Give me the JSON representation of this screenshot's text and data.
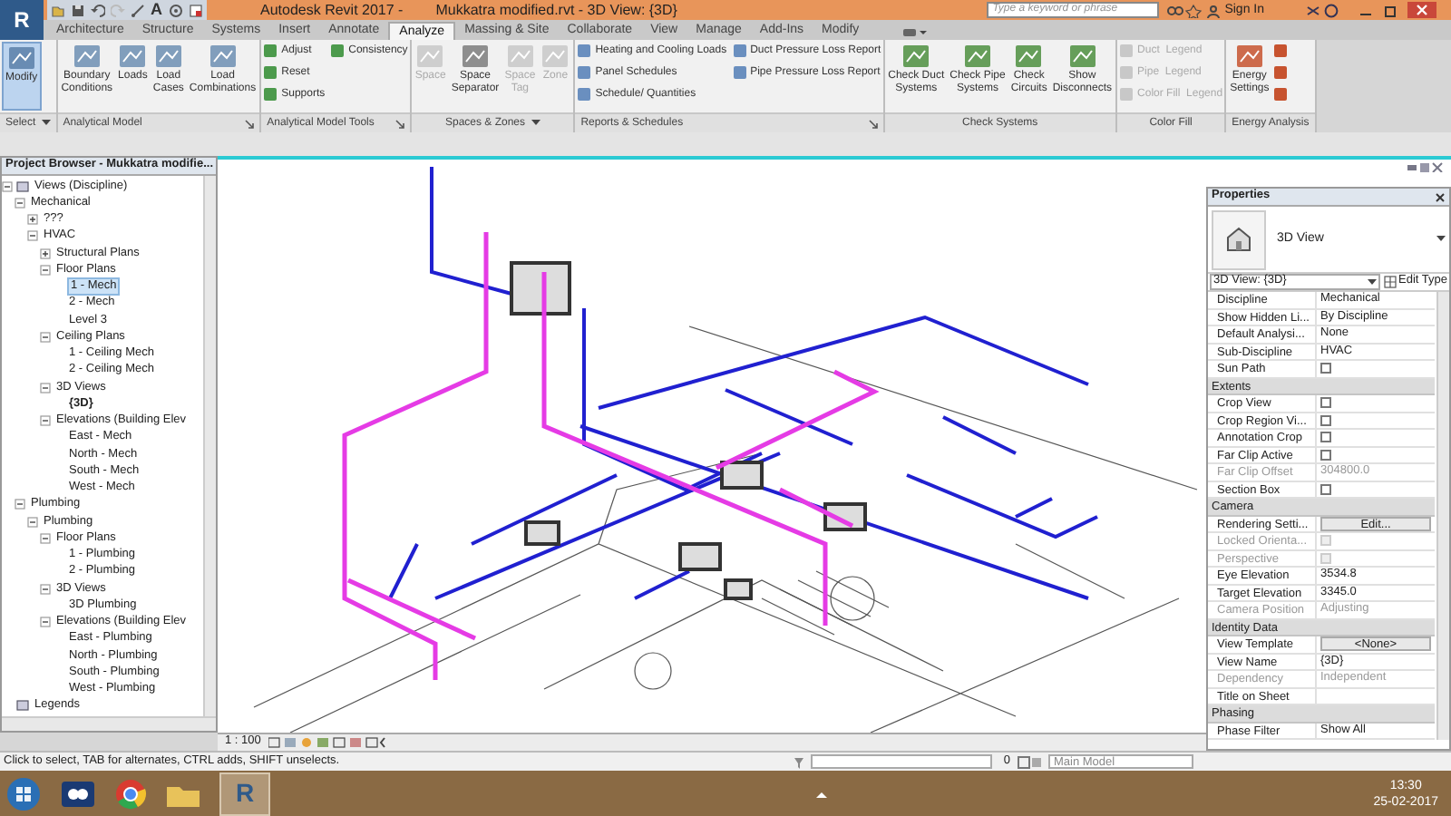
{
  "title_bar": {
    "app_letter": "R",
    "text_tool": "A",
    "title": "Autodesk Revit 2017 -",
    "document": "Mukkatra modified.rvt - 3D View: {3D}",
    "search": {
      "placeholder": "Type a keyword or phrase"
    },
    "sign_in": "Sign In"
  },
  "tabs": [
    {
      "label": "Architecture",
      "selected": false
    },
    {
      "label": "Structure",
      "selected": false
    },
    {
      "label": "Systems",
      "selected": false
    },
    {
      "label": "Insert",
      "selected": false
    },
    {
      "label": "Annotate",
      "selected": false
    },
    {
      "label": "Analyze",
      "selected": true
    },
    {
      "label": "Massing & Site",
      "selected": false
    },
    {
      "label": "Collaborate",
      "selected": false
    },
    {
      "label": "View",
      "selected": false
    },
    {
      "label": "Manage",
      "selected": false
    },
    {
      "label": "Add-Ins",
      "selected": false
    },
    {
      "label": "Modify",
      "selected": false
    }
  ],
  "ribbon": {
    "panels": [
      {
        "label": "Select",
        "dropdown": true,
        "launcher": false,
        "tools": [
          {
            "kind": "large",
            "label": "Modify",
            "active": true,
            "disabled": false
          }
        ]
      },
      {
        "label": "Analytical Model",
        "dropdown": false,
        "launcher": true,
        "tools": [
          {
            "kind": "large",
            "label": "Boundary\nConditions",
            "active": false,
            "disabled": false
          },
          {
            "kind": "large",
            "label": "Loads",
            "active": false,
            "disabled": false
          },
          {
            "kind": "large",
            "label": "Load\nCases",
            "active": false,
            "disabled": false
          },
          {
            "kind": "large",
            "label": "Load\nCombinations",
            "active": false,
            "disabled": false
          }
        ]
      },
      {
        "label": "Analytical Model Tools",
        "dropdown": false,
        "launcher": true,
        "tools": [
          {
            "kind": "small",
            "label": "Adjust",
            "disabled": false
          },
          {
            "kind": "small",
            "label": "Reset",
            "disabled": false
          },
          {
            "kind": "small",
            "label": "Supports",
            "disabled": false
          },
          {
            "kind": "small",
            "label": "Consistency",
            "disabled": false
          }
        ]
      },
      {
        "label": "Spaces & Zones",
        "dropdown": true,
        "launcher": false,
        "tools": [
          {
            "kind": "large",
            "label": "Space",
            "active": false,
            "disabled": true
          },
          {
            "kind": "large",
            "label": "Space\nSeparator",
            "active": false,
            "disabled": false
          },
          {
            "kind": "large",
            "label": "Space\nTag",
            "active": false,
            "disabled": true
          },
          {
            "kind": "large",
            "label": "Zone",
            "active": false,
            "disabled": true
          }
        ]
      },
      {
        "label": "Reports & Schedules",
        "dropdown": false,
        "launcher": true,
        "tools": [
          {
            "kind": "small",
            "label": "Heating and Cooling Loads",
            "disabled": false
          },
          {
            "kind": "small",
            "label": "Panel Schedules",
            "disabled": false
          },
          {
            "kind": "small",
            "label": "Schedule/ Quantities",
            "disabled": false
          },
          {
            "kind": "small",
            "label": "Duct Pressure Loss Report",
            "disabled": false
          },
          {
            "kind": "small",
            "label": "Pipe Pressure Loss Report",
            "disabled": false
          }
        ]
      },
      {
        "label": "Check Systems",
        "dropdown": false,
        "launcher": false,
        "tools": [
          {
            "kind": "large",
            "label": "Check Duct\nSystems",
            "active": false,
            "disabled": false
          },
          {
            "kind": "large",
            "label": "Check Pipe\nSystems",
            "active": false,
            "disabled": false
          },
          {
            "kind": "large",
            "label": "Check\nCircuits",
            "active": false,
            "disabled": false
          },
          {
            "kind": "large",
            "label": "Show\nDisconnects",
            "active": false,
            "disabled": false
          }
        ]
      },
      {
        "label": "Color Fill",
        "dropdown": false,
        "launcher": false,
        "tools": [
          {
            "kind": "small",
            "label": "Duct  Legend",
            "disabled": true
          },
          {
            "kind": "small",
            "label": "Pipe  Legend",
            "disabled": true
          },
          {
            "kind": "small",
            "label": "Color Fill  Legend",
            "disabled": true
          }
        ]
      },
      {
        "label": "Energy Analysis",
        "dropdown": false,
        "launcher": false,
        "tools": [
          {
            "kind": "large",
            "label": "Energy\nSettings",
            "active": false,
            "disabled": false
          },
          {
            "kind": "icon",
            "disabled": false
          },
          {
            "kind": "icon",
            "disabled": false
          },
          {
            "kind": "icon",
            "disabled": false
          }
        ]
      }
    ]
  },
  "project_browser": {
    "title": "Project Browser - Mukkatra modifie...",
    "tree": [
      {
        "label": "Views (Discipline)",
        "expanded": true,
        "selected": false,
        "current": false,
        "children": [
          {
            "label": "Mechanical",
            "expanded": true,
            "selected": false,
            "current": false,
            "children": [
              {
                "label": "???",
                "expanded": false,
                "selected": false,
                "current": false
              },
              {
                "label": "HVAC",
                "expanded": true,
                "selected": false,
                "current": false,
                "children": [
                  {
                    "label": "Structural Plans",
                    "expanded": false,
                    "selected": false,
                    "current": false
                  },
                  {
                    "label": "Floor Plans",
                    "expanded": true,
                    "selected": false,
                    "current": false,
                    "children": [
                      {
                        "label": "1 - Mech",
                        "selected": true,
                        "current": false
                      },
                      {
                        "label": "2 - Mech",
                        "selected": false,
                        "current": false
                      },
                      {
                        "label": "Level 3",
                        "selected": false,
                        "current": false
                      }
                    ]
                  },
                  {
                    "label": "Ceiling Plans",
                    "expanded": true,
                    "selected": false,
                    "current": false,
                    "children": [
                      {
                        "label": "1 - Ceiling Mech",
                        "selected": false,
                        "current": false
                      },
                      {
                        "label": "2 - Ceiling Mech",
                        "selected": false,
                        "current": false
                      }
                    ]
                  },
                  {
                    "label": "3D Views",
                    "expanded": true,
                    "selected": false,
                    "current": false,
                    "children": [
                      {
                        "label": "{3D}",
                        "selected": false,
                        "current": true
                      }
                    ]
                  },
                  {
                    "label": "Elevations (Building Elev",
                    "expanded": true,
                    "selected": false,
                    "current": false,
                    "children": [
                      {
                        "label": "East - Mech",
                        "selected": false,
                        "current": false
                      },
                      {
                        "label": "North - Mech",
                        "selected": false,
                        "current": false
                      },
                      {
                        "label": "South - Mech",
                        "selected": false,
                        "current": false
                      },
                      {
                        "label": "West - Mech",
                        "selected": false,
                        "current": false
                      }
                    ]
                  }
                ]
              }
            ]
          },
          {
            "label": "Plumbing",
            "expanded": true,
            "selected": false,
            "current": false,
            "children": [
              {
                "label": "Plumbing",
                "expanded": true,
                "selected": false,
                "current": false,
                "children": [
                  {
                    "label": "Floor Plans",
                    "expanded": true,
                    "selected": false,
                    "current": false,
                    "children": [
                      {
                        "label": "1 - Plumbing",
                        "selected": false,
                        "current": false
                      },
                      {
                        "label": "2 - Plumbing",
                        "selected": false,
                        "current": false
                      }
                    ]
                  },
                  {
                    "label": "3D Views",
                    "expanded": true,
                    "selected": false,
                    "current": false,
                    "children": [
                      {
                        "label": "3D Plumbing",
                        "selected": false,
                        "current": false
                      }
                    ]
                  },
                  {
                    "label": "Elevations (Building Elev",
                    "expanded": true,
                    "selected": false,
                    "current": false,
                    "children": [
                      {
                        "label": "East - Plumbing",
                        "selected": false,
                        "current": false
                      },
                      {
                        "label": "North - Plumbing",
                        "selected": false,
                        "current": false
                      },
                      {
                        "label": "South - Plumbing",
                        "selected": false,
                        "current": false
                      },
                      {
                        "label": "West - Plumbing",
                        "selected": false,
                        "current": false
                      }
                    ]
                  }
                ]
              }
            ]
          }
        ]
      },
      {
        "label": "Legends",
        "selected": false,
        "current": false
      }
    ]
  },
  "view_control_bar": {
    "scale": "1 : 100"
  },
  "properties": {
    "title": "Properties",
    "type": "3D View",
    "selector": "3D View: {3D}",
    "edit_type": "Edit Type",
    "rows": [
      {
        "kind": "text",
        "label": "Discipline",
        "value": "Mechanical",
        "disabled": false
      },
      {
        "kind": "text",
        "label": "Show Hidden Li...",
        "value": "By Discipline",
        "disabled": false
      },
      {
        "kind": "text",
        "label": "Default Analysi...",
        "value": "None",
        "disabled": false
      },
      {
        "kind": "text",
        "label": "Sub-Discipline",
        "value": "HVAC",
        "disabled": false
      },
      {
        "kind": "checkbox",
        "label": "Sun Path",
        "checked": false,
        "disabled": false
      },
      {
        "kind": "group",
        "label": "Extents"
      },
      {
        "kind": "checkbox",
        "label": "Crop View",
        "checked": false,
        "disabled": false
      },
      {
        "kind": "checkbox",
        "label": "Crop Region Vi...",
        "checked": false,
        "disabled": false
      },
      {
        "kind": "checkbox",
        "label": "Annotation Crop",
        "checked": false,
        "disabled": false
      },
      {
        "kind": "checkbox",
        "label": "Far Clip Active",
        "checked": false,
        "disabled": false
      },
      {
        "kind": "text",
        "label": "Far Clip Offset",
        "value": "304800.0",
        "disabled": true
      },
      {
        "kind": "checkbox",
        "label": "Section Box",
        "checked": false,
        "disabled": false
      },
      {
        "kind": "group",
        "label": "Camera"
      },
      {
        "kind": "button",
        "label": "Rendering Setti...",
        "value": "Edit...",
        "disabled": false
      },
      {
        "kind": "checkbox",
        "label": "Locked Orienta...",
        "checked": false,
        "disabled": true
      },
      {
        "kind": "checkbox",
        "label": "Perspective",
        "checked": false,
        "disabled": true
      },
      {
        "kind": "text",
        "label": "Eye Elevation",
        "value": "3534.8",
        "disabled": false
      },
      {
        "kind": "text",
        "label": "Target Elevation",
        "value": "3345.0",
        "disabled": false
      },
      {
        "kind": "text",
        "label": "Camera Position",
        "value": "Adjusting",
        "disabled": true
      },
      {
        "kind": "group",
        "label": "Identity Data"
      },
      {
        "kind": "button",
        "label": "View Template",
        "value": "<None>",
        "disabled": false
      },
      {
        "kind": "text",
        "label": "View Name",
        "value": "{3D}",
        "disabled": false
      },
      {
        "kind": "text",
        "label": "Dependency",
        "value": "Independent",
        "disabled": true
      },
      {
        "kind": "text",
        "label": "Title on Sheet",
        "value": "",
        "disabled": false
      },
      {
        "kind": "group",
        "label": "Phasing"
      },
      {
        "kind": "text",
        "label": "Phase Filter",
        "value": "Show All",
        "disabled": false
      }
    ]
  },
  "status_bar": {
    "hint": "Click to select, TAB for alternates, CTRL adds, SHIFT unselects.",
    "selection_count": "0",
    "model": "Main Model"
  },
  "taskbar": {
    "revit_letter": "R",
    "time": "13:30",
    "date": "25-02-2017"
  }
}
